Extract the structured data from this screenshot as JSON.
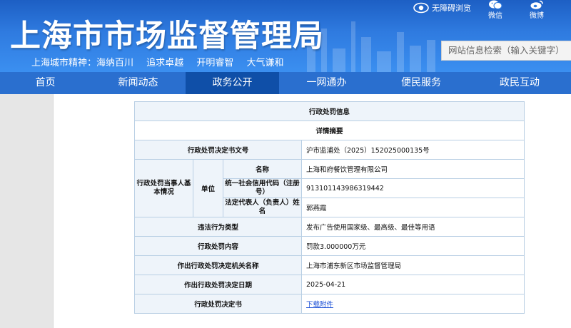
{
  "header": {
    "title": "上海市市场监督管理局",
    "slogan": [
      "上海城市精神：海纳百川",
      "追求卓越",
      "开明睿智",
      "大气谦和"
    ],
    "accessibility_label": "无障碍浏览",
    "wechat_label": "微信",
    "weibo_label": "微博",
    "search_placeholder": "网站信息检索（输入关键字）"
  },
  "nav": {
    "items": [
      "首页",
      "新闻动态",
      "政务公开",
      "一网通办",
      "便民服务",
      "政民互动"
    ],
    "active_index": 2,
    "active_color": "#0f4fa8"
  },
  "detail": {
    "heading": "行政处罚信息",
    "summary": "详情摘要",
    "doc_no_label": "行政处罚决定书文号",
    "doc_no": "沪市监浦处（2025）152025000135号",
    "party_label": "行政处罚当事人基本情况",
    "unit_label": "单位",
    "name_label": "名称",
    "name": "上海和府餐饮管理有限公司",
    "credit_code_label": "统一社会信用代码（注册号）",
    "credit_code": "913101143986319442",
    "legal_rep_label": "法定代表人（负责人）姓名",
    "legal_rep": "郭燕霞",
    "violation_type_label": "违法行为类型",
    "violation_type": "发布广告使用国家级、最高级、最佳等用语",
    "penalty_content_label": "行政处罚内容",
    "penalty_content": "罚款3.000000万元",
    "authority_label": "作出行政处罚决定机关名称",
    "authority": "上海市浦东新区市场监督管理局",
    "date_label": "作出行政处罚决定日期",
    "date": "2025-04-21",
    "decision_doc_label": "行政处罚决定书",
    "download_label": "下载附件"
  }
}
